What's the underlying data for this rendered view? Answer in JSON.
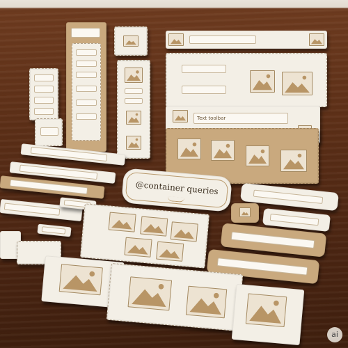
{
  "scene": {
    "badge_text": "@container queries",
    "toolbar_label": "Text toolbar",
    "watermark": "ai"
  },
  "colors": {
    "wood": "#5a2f18",
    "paper": "#f3efe6",
    "kraft": "#c9a97e",
    "ink": "#6a5538"
  },
  "icons": [
    "image-icon",
    "chevron-down-icon",
    "ornament-icon"
  ]
}
